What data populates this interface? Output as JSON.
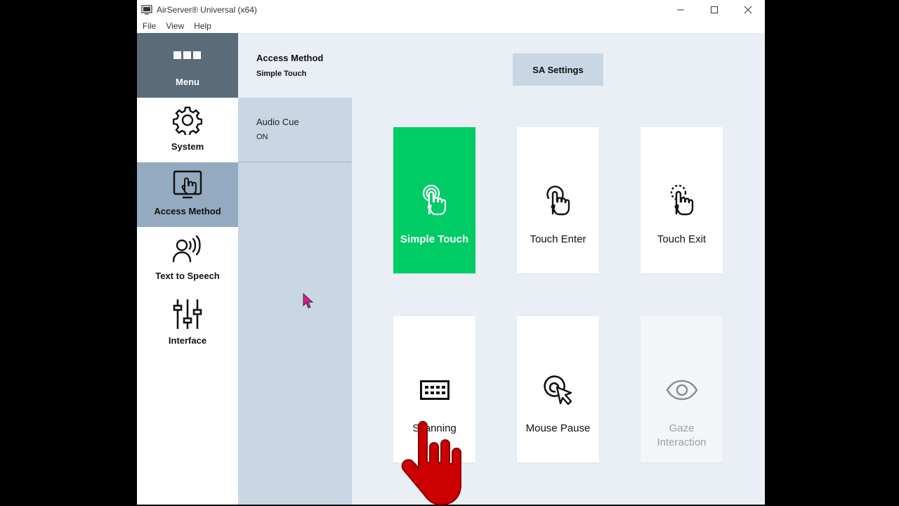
{
  "window": {
    "title": "AirServer® Universal (x64)",
    "menus": [
      "File",
      "View",
      "Help"
    ]
  },
  "sidebar": {
    "items": [
      {
        "label": "Menu",
        "icon": "menu-dots-icon"
      },
      {
        "label": "System",
        "icon": "gear-icon"
      },
      {
        "label": "Access Method",
        "icon": "touch-screen-icon",
        "active": true
      },
      {
        "label": "Text to Speech",
        "icon": "speaking-head-icon"
      },
      {
        "label": "Interface",
        "icon": "sliders-icon"
      }
    ]
  },
  "subpanel": {
    "title": "Access Method",
    "value": "Simple Touch",
    "audio_cue": {
      "label": "Audio Cue",
      "value": "ON"
    }
  },
  "main": {
    "sa_settings_label": "SA Settings",
    "tiles": [
      {
        "label": "Simple Touch",
        "icon": "simple-touch-icon",
        "selected": true
      },
      {
        "label": "Touch Enter",
        "icon": "touch-enter-icon"
      },
      {
        "label": "Touch Exit",
        "icon": "touch-exit-icon"
      },
      {
        "label": "Scanning",
        "icon": "scanning-icon"
      },
      {
        "label": "Mouse Pause",
        "icon": "mouse-pause-icon"
      },
      {
        "label": "Gaze Interaction",
        "icon": "eye-icon",
        "disabled": true
      }
    ]
  },
  "colors": {
    "selected_tile": "#00cc66",
    "menu_bg": "#5a6b7a",
    "active_bg": "#93aac0",
    "panel_bg": "#c8d7e3",
    "hand_overlay": "#cc0000"
  }
}
